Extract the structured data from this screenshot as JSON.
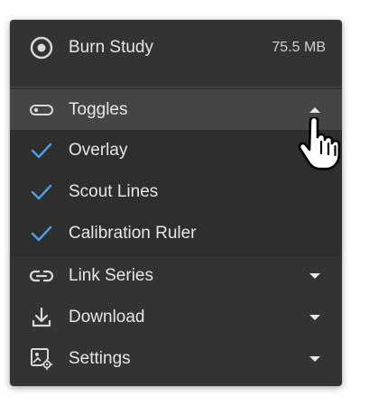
{
  "study": {
    "label": "Burn Study",
    "size": "75.5 MB",
    "icon": "disc-icon"
  },
  "toggles": {
    "label": "Toggles",
    "icon": "toggle-icon",
    "expanded": true,
    "items": [
      {
        "label": "Overlay",
        "checked": true
      },
      {
        "label": "Scout Lines",
        "checked": true
      },
      {
        "label": "Calibration Ruler",
        "checked": true
      }
    ]
  },
  "menu_items": [
    {
      "label": "Link Series",
      "icon": "link-icon"
    },
    {
      "label": "Download",
      "icon": "download-icon"
    },
    {
      "label": "Settings",
      "icon": "image-settings-icon"
    }
  ],
  "colors": {
    "menu_background": "#333333",
    "hover_background": "#454545",
    "submenu_background": "#2e2e2e",
    "check_color": "#4a9fe8",
    "text": "#e6e6e6"
  }
}
